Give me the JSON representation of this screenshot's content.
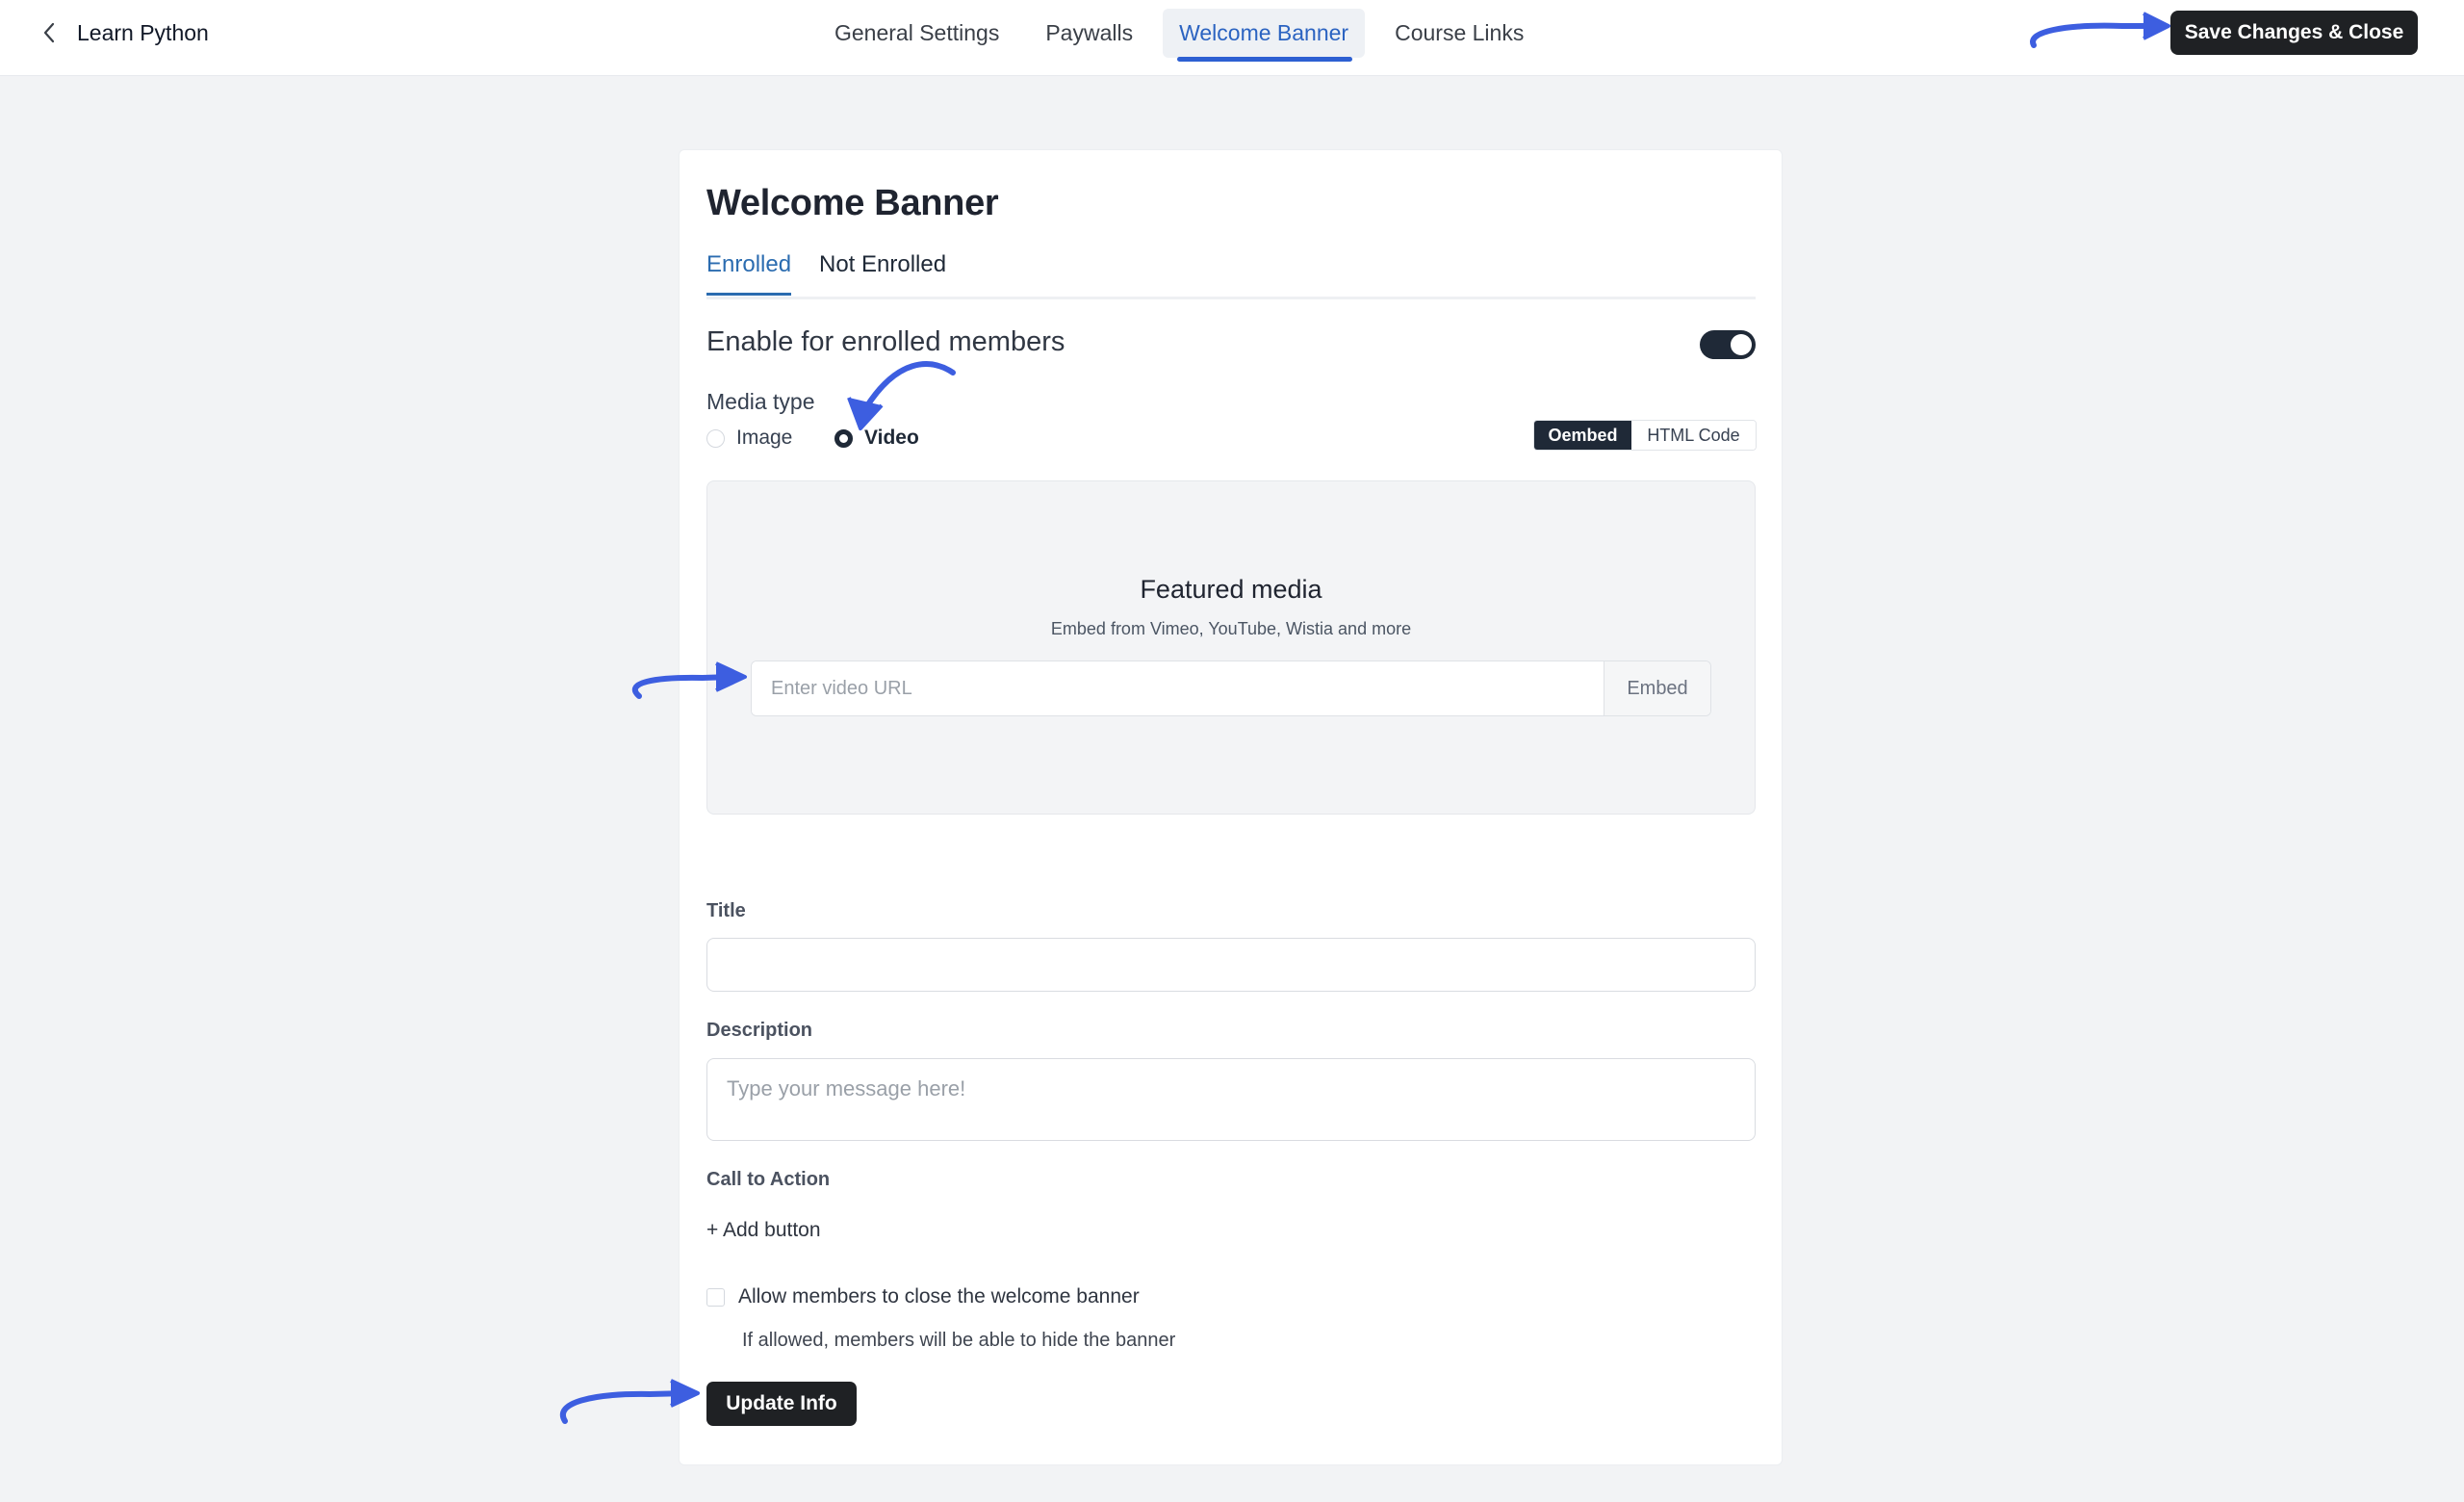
{
  "header": {
    "back_label": "Learn Python",
    "tabs": [
      {
        "label": "General Settings",
        "active": false
      },
      {
        "label": "Paywalls",
        "active": false
      },
      {
        "label": "Welcome Banner",
        "active": true
      },
      {
        "label": "Course Links",
        "active": false
      }
    ],
    "save_label": "Save Changes & Close"
  },
  "card": {
    "title": "Welcome Banner",
    "subtabs": [
      {
        "label": "Enrolled",
        "active": true
      },
      {
        "label": "Not Enrolled",
        "active": false
      }
    ],
    "enable_label": "Enable for enrolled members",
    "enable_on": true,
    "media_type_label": "Media type",
    "media_options": [
      {
        "label": "Image",
        "checked": false
      },
      {
        "label": "Video",
        "checked": true
      }
    ],
    "embed_modes": [
      {
        "label": "Oembed",
        "active": true
      },
      {
        "label": "HTML Code",
        "active": false
      }
    ],
    "featured": {
      "title": "Featured media",
      "subtitle": "Embed from Vimeo, YouTube, Wistia and more",
      "url_placeholder": "Enter video URL",
      "url_value": "",
      "embed_label": "Embed"
    },
    "title_label": "Title",
    "title_value": "",
    "description_label": "Description",
    "description_placeholder": "Type your message here!",
    "cta_label": "Call to Action",
    "add_button_label": "+ Add button",
    "allow_close_label": "Allow members to close the welcome banner",
    "allow_close_checked": false,
    "allow_close_help": "If allowed, members will be able to hide the banner",
    "update_label": "Update Info"
  },
  "colors": {
    "accent": "#2b6cb0",
    "annotation_arrow": "#3d5ee0",
    "dark_button": "#1f2124",
    "background": "#f2f3f5"
  }
}
